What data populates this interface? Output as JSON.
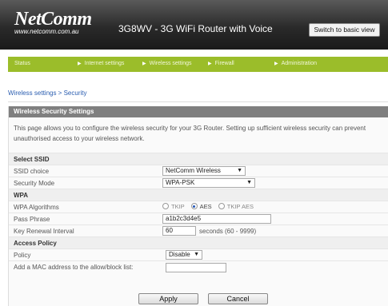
{
  "header": {
    "logo": "NetComm",
    "logo_url": "www.netcomm.com.au",
    "router_title": "3G8WV - 3G WiFi Router with Voice",
    "basic_view_button": "Switch to basic view"
  },
  "nav": {
    "items": [
      {
        "label": "Status"
      },
      {
        "label": "Internet settings"
      },
      {
        "label": "Wireless settings"
      },
      {
        "label": "Firewall"
      },
      {
        "label": "Administration"
      }
    ]
  },
  "breadcrumb": "Wireless settings > Security",
  "panel": {
    "title": "Wireless Security Settings",
    "description": "This page allows you to configure the wireless security for your 3G Router. Setting up sufficient wireless security can prevent unauthorised access to your wireless network."
  },
  "ssid": {
    "section_label": "Select SSID",
    "choice_label": "SSID choice",
    "choice_value": "NetComm Wireless",
    "mode_label": "Security Mode",
    "mode_value": "WPA-PSK"
  },
  "wpa": {
    "section_label": "WPA",
    "algorithms_label": "WPA Algorithms",
    "algorithms": [
      {
        "label": "TKIP",
        "selected": false
      },
      {
        "label": "AES",
        "selected": true
      },
      {
        "label": "TKIP AES",
        "selected": false
      }
    ],
    "passphrase_label": "Pass Phrase",
    "passphrase_value": "a1b2c3d4e5",
    "renewal_label": "Key Renewal Interval",
    "renewal_value": "60",
    "renewal_hint": "seconds (60 - 9999)"
  },
  "access": {
    "section_label": "Access Policy",
    "policy_label": "Policy",
    "policy_value": "Disable",
    "mac_label": "Add a MAC address to the allow/block list:",
    "mac_value": ""
  },
  "buttons": {
    "apply": "Apply",
    "cancel": "Cancel"
  },
  "colors": {
    "nav_green": "#9bbd2a",
    "header_dark": "#2a2a2a",
    "panel_title": "#7f7f7f",
    "link_blue": "#2a5db0"
  }
}
